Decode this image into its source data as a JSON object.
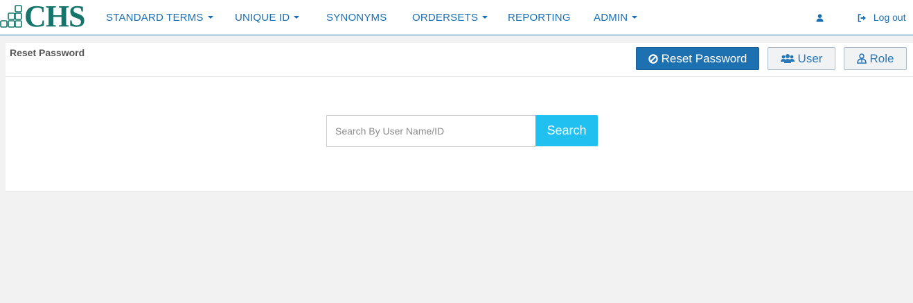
{
  "brand": {
    "logo_text": "CHS",
    "logo_color": "#16756a"
  },
  "nav": {
    "items": [
      {
        "label": "STANDARD TERMS",
        "dropdown": true
      },
      {
        "label": "UNIQUE ID",
        "dropdown": true
      },
      {
        "label": "SYNONYMS",
        "dropdown": false
      },
      {
        "label": "ORDERSETS",
        "dropdown": true
      },
      {
        "label": "REPORTING",
        "dropdown": false
      },
      {
        "label": "ADMIN",
        "dropdown": true
      }
    ],
    "user_icon": "user-icon",
    "logout_icon": "sign-out-icon",
    "logout_label": "Log out"
  },
  "panel": {
    "title": "Reset Password",
    "buttons": {
      "reset_password": {
        "label": "Reset Password",
        "icon": "ban-circle-icon"
      },
      "user": {
        "label": "User",
        "icon": "users-icon"
      },
      "role": {
        "label": "Role",
        "icon": "user-role-icon"
      }
    }
  },
  "search": {
    "placeholder": "Search By User Name/ID",
    "value": "",
    "button_label": "Search"
  },
  "colors": {
    "link": "#1a6fb4",
    "primary": "#1d71b1",
    "search_button": "#20c0f0",
    "background": "#f2f2f2"
  }
}
